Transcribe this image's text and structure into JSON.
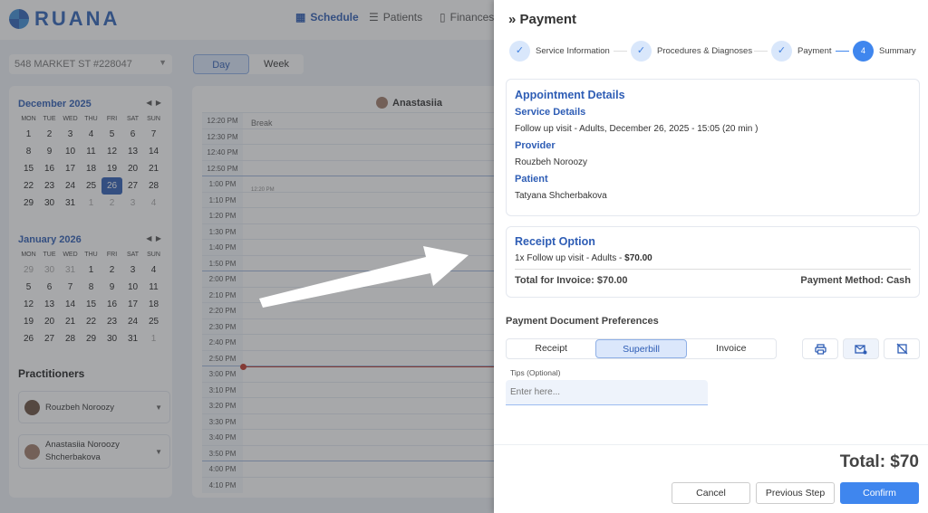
{
  "header": {
    "logo": "RUANA",
    "nav": [
      {
        "label": "Schedule",
        "icon": "calendar-icon",
        "active": true
      },
      {
        "label": "Patients",
        "icon": "patients-icon"
      },
      {
        "label": "Finances",
        "icon": "finance-doc-icon"
      }
    ]
  },
  "location": {
    "value": "548 MARKET ST #228047"
  },
  "view_toggle": {
    "day": "Day",
    "week": "Week",
    "active": "Day"
  },
  "calendars": [
    {
      "title": "December 2025",
      "dow": [
        "MON",
        "TUE",
        "WED",
        "THU",
        "FRI",
        "SAT",
        "SUN"
      ],
      "days": [
        "1",
        "2",
        "3",
        "4",
        "5",
        "6",
        "7",
        "8",
        "9",
        "10",
        "11",
        "12",
        "13",
        "14",
        "15",
        "16",
        "17",
        "18",
        "19",
        "20",
        "21",
        "22",
        "23",
        "24",
        "25",
        "26",
        "27",
        "28",
        "29",
        "30",
        "31",
        "1",
        "2",
        "3",
        "4"
      ],
      "muted": [
        31,
        32,
        33,
        34
      ],
      "selected": 25
    },
    {
      "title": "January 2026",
      "dow": [
        "MON",
        "TUE",
        "WED",
        "THU",
        "FRI",
        "SAT",
        "SUN"
      ],
      "days": [
        "29",
        "30",
        "31",
        "1",
        "2",
        "3",
        "4",
        "5",
        "6",
        "7",
        "8",
        "9",
        "10",
        "11",
        "12",
        "13",
        "14",
        "15",
        "16",
        "17",
        "18",
        "19",
        "20",
        "21",
        "22",
        "23",
        "24",
        "25",
        "26",
        "27",
        "28",
        "29",
        "30",
        "31",
        "1"
      ],
      "muted": [
        0,
        1,
        2,
        34
      ],
      "selected": -1
    }
  ],
  "practitioners": {
    "title": "Practitioners",
    "items": [
      "Rouzbeh Noroozy",
      "Anastasiia Noroozy Shcherbakova"
    ]
  },
  "schedule": {
    "column": "Anastasiia",
    "break_label": "Break",
    "break_time": "12:20 PM",
    "times": [
      "12:20 PM",
      "12:30 PM",
      "12:40 PM",
      "12:50 PM",
      "1:00 PM",
      "1:10 PM",
      "1:20 PM",
      "1:30 PM",
      "1:40 PM",
      "1:50 PM",
      "2:00 PM",
      "2:10 PM",
      "2:20 PM",
      "2:30 PM",
      "2:40 PM",
      "2:50 PM",
      "3:00 PM",
      "3:10 PM",
      "3:20 PM",
      "3:30 PM",
      "3:40 PM",
      "3:50 PM",
      "4:00 PM",
      "4:10 PM"
    ],
    "current_time_color": "#c0392b"
  },
  "panel": {
    "title": "Payment",
    "steps": [
      {
        "label": "Service Information",
        "done": true
      },
      {
        "label": "Procedures & Diagnoses",
        "done": true
      },
      {
        "label": "Payment",
        "done": true
      },
      {
        "label": "Summary",
        "number": "4",
        "current": true
      }
    ],
    "appointment": {
      "title": "Appointment Details",
      "service_label": "Service Details",
      "service": "Follow up visit - Adults, December 26, 2025 - 15:05 (20 min )",
      "provider_label": "Provider",
      "provider": "Rouzbeh Noroozy",
      "patient_label": "Patient",
      "patient": "Tatyana Shcherbakova"
    },
    "receipt": {
      "title": "Receipt Option",
      "line": "1x Follow up visit - Adults - ",
      "line_amount": "$70.00",
      "total": "Total for Invoice: $70.00",
      "method": "Payment Method: Cash"
    },
    "prefs": {
      "title": "Payment Document Preferences",
      "tabs": [
        "Receipt",
        "Superbill",
        "Invoice"
      ],
      "active": "Superbill",
      "icons": [
        "printer-icon",
        "email-icon",
        "no-print-icon"
      ]
    },
    "tips": {
      "label": "Tips (Optional)",
      "placeholder": "Enter here..."
    },
    "total": "Total: $70",
    "buttons": {
      "cancel": "Cancel",
      "previous": "Previous Step",
      "confirm": "Confirm"
    },
    "accent": "#3f86ee"
  }
}
